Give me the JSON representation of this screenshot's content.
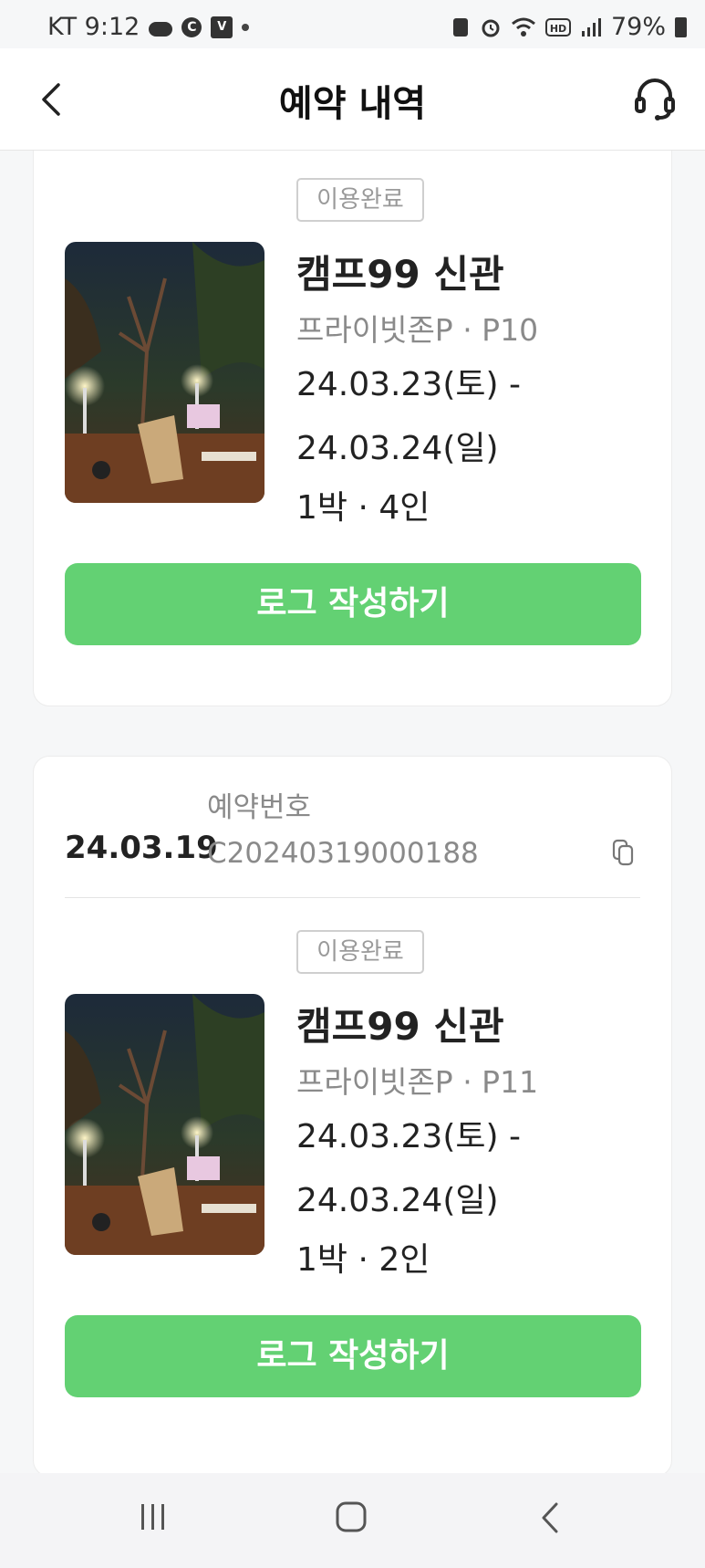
{
  "status_bar": {
    "carrier_time": "KT 9:12",
    "icon_c": "C",
    "icon_v": "V",
    "battery": "79%"
  },
  "header": {
    "title": "예약 내역",
    "back_icon": "chevron-left-icon",
    "support_icon": "headset-icon"
  },
  "reservations": [
    {
      "status": "이용완료",
      "place": "캠프99 신관",
      "site": "프라이빗존P · P10",
      "date_from": "24.03.23(토) -",
      "date_to": "24.03.24(일)",
      "stay": "1박 · 4인",
      "action": "로그 작성하기"
    },
    {
      "order_date": "24.03.19",
      "order_label": "예약번호",
      "order_number": "C20240319000188",
      "status": "이용완료",
      "place": "캠프99 신관",
      "site": "프라이빗존P · P11",
      "date_from": "24.03.23(토) -",
      "date_to": "24.03.24(일)",
      "stay": "1박 · 2인",
      "action": "로그 작성하기"
    }
  ],
  "colors": {
    "accent_green": "#63d173",
    "muted_text": "#8a8a8a"
  },
  "nav": {
    "recent_icon": "recent-apps-icon",
    "home_icon": "home-icon",
    "back_icon": "back-icon"
  }
}
